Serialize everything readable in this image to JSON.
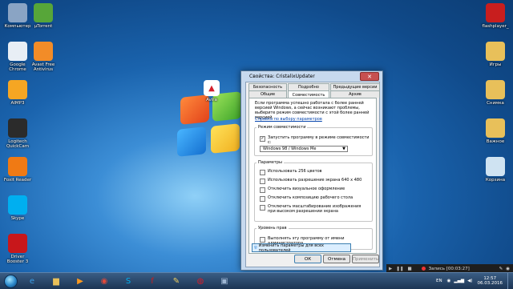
{
  "colors": {
    "accent": "#3c7fb1",
    "close": "#c75050",
    "taskbar": "#2a4a6f"
  },
  "desktop_icons_left": [
    {
      "id": "computer",
      "label": "Компьютер",
      "icon": "computer-icon",
      "color": "#8aa4c4"
    },
    {
      "id": "google-chrome",
      "label": "Google\nChrome",
      "icon": "chrome-icon",
      "color": "#e8eef5"
    },
    {
      "id": "aimp3",
      "label": "AIMP3",
      "icon": "aimp-icon",
      "color": "#f5a623"
    },
    {
      "id": "logitech",
      "label": "Logitech\nQuickCam",
      "icon": "webcam-icon",
      "color": "#2b2b2b"
    },
    {
      "id": "foxit",
      "label": "Foxit Reader",
      "icon": "foxit-icon",
      "color": "#f07a14"
    },
    {
      "id": "skype",
      "label": "Skype",
      "icon": "skype-icon",
      "color": "#00aff0"
    },
    {
      "id": "driver-booster",
      "label": "Driver\nBooster 3",
      "icon": "booster-icon",
      "color": "#c8171b"
    }
  ],
  "desktop_icons_col2": [
    {
      "id": "utorrent",
      "label": "µTorrent",
      "icon": "utorrent-icon",
      "color": "#57a639"
    },
    {
      "id": "avast",
      "label": "Avast Free\nAntivirus",
      "icon": "avast-icon",
      "color": "#f28c28"
    }
  ],
  "desktop_icons_right": [
    {
      "id": "flashplayer",
      "label": "flashplayer_",
      "icon": "flash-icon",
      "color": "#c81e1e"
    },
    {
      "id": "games",
      "label": "Игры",
      "icon": "folder-icon",
      "color": "#e8c05a"
    },
    {
      "id": "snimka",
      "label": "Снимка",
      "icon": "folder-icon",
      "color": "#e8c05a"
    },
    {
      "id": "vazhnoe",
      "label": "Важное",
      "icon": "folder-icon",
      "color": "#e8c05a"
    },
    {
      "id": "recycle",
      "label": "Корзина",
      "icon": "recycle-bin-icon",
      "color": "#cfe3f2"
    }
  ],
  "avira_label": "Avira",
  "dialog": {
    "title": "Свойства: CristalixUpdater",
    "close_glyph": "✕",
    "tabs_back": [
      "Безопасность",
      "Подробно",
      "Предыдущие версии"
    ],
    "tabs_front": [
      "Общие",
      "Совместимость",
      "Архив"
    ],
    "intro": "Если программа успешно работала с более ранней версией Windows, а сейчас возникают проблемы, выберите режим совместимости с этой более ранней версией.",
    "help_link": "Справка по выбору параметров",
    "compat_group": "Режим совместимости",
    "compat_checkbox": "Запустить программу в режиме совместимости с:",
    "compat_select": "Windows 98 / Windows Me",
    "params_group": "Параметры",
    "params": [
      "Использовать 256 цветов",
      "Использовать разрешение экрана 640 x 480",
      "Отключить визуальное оформление",
      "Отключить композицию рабочего стола",
      "Отключить масштабирование изображения при высоком разрешении экрана"
    ],
    "rights_group": "Уровень прав",
    "admin_checkbox": "Выполнять эту программу от имени администратора",
    "change_all": "Изменить параметры для всех пользователей",
    "ok": "ОК",
    "cancel": "Отмена",
    "apply": "Применить"
  },
  "recording": {
    "text": "Запись [00:03:27]"
  },
  "taskbar": {
    "lang": "EN",
    "time": "12:57",
    "date": "06.03.2016",
    "pinned": [
      {
        "id": "ie",
        "icon": "internet-explorer-icon",
        "glyph": "e",
        "color": "#3a9ee8"
      },
      {
        "id": "explorer",
        "icon": "explorer-folder-icon",
        "glyph": "▆",
        "color": "#e8c05a"
      },
      {
        "id": "wmp",
        "icon": "media-player-icon",
        "glyph": "▶",
        "color": "#ff9a1f"
      },
      {
        "id": "chrome",
        "icon": "chrome-icon",
        "glyph": "◉",
        "color": "#e04a3b"
      },
      {
        "id": "skype",
        "icon": "skype-icon",
        "glyph": "S",
        "color": "#00aff0"
      },
      {
        "id": "flash",
        "icon": "flash-icon",
        "glyph": "f",
        "color": "#c81e1e"
      },
      {
        "id": "paint",
        "icon": "paint-icon",
        "glyph": "✎",
        "color": "#f0d060"
      },
      {
        "id": "avira",
        "icon": "avira-icon",
        "glyph": "◍",
        "color": "#d41e2b"
      },
      {
        "id": "app",
        "icon": "app-window-icon",
        "glyph": "▣",
        "color": "#9db6d3"
      }
    ]
  }
}
